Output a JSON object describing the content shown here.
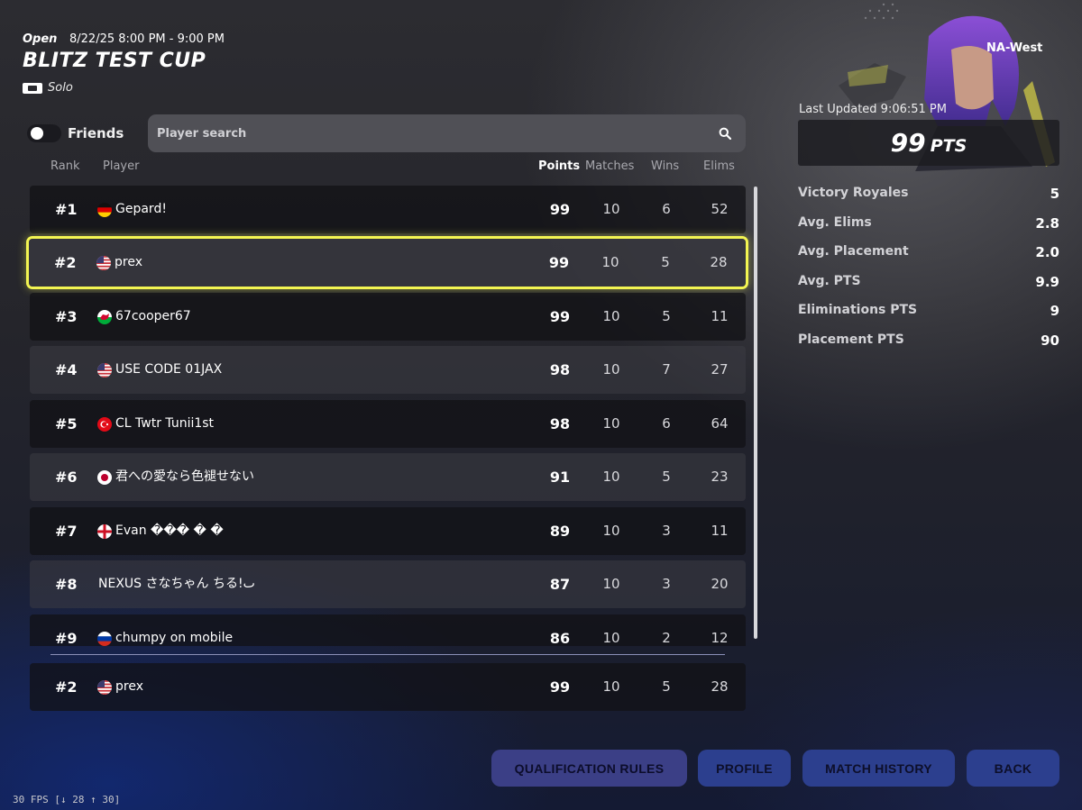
{
  "header": {
    "status": "Open",
    "datetime": "8/22/25 8:00 PM - 9:00 PM",
    "title": "BLITZ TEST CUP",
    "mode": "Solo"
  },
  "filters": {
    "friends_label": "Friends",
    "friends_enabled": false,
    "search_placeholder": "Player search"
  },
  "columns": {
    "rank": "Rank",
    "player": "Player",
    "points": "Points",
    "matches": "Matches",
    "wins": "Wins",
    "elims": "Elims"
  },
  "rows": [
    {
      "rank": "#1",
      "flag": "germany",
      "name": "Gepard!",
      "points": "99",
      "matches": "10",
      "wins": "6",
      "elims": "52"
    },
    {
      "rank": "#2",
      "flag": "usa",
      "name": "prex",
      "points": "99",
      "matches": "10",
      "wins": "5",
      "elims": "28",
      "selected": true
    },
    {
      "rank": "#3",
      "flag": "wales",
      "name": "67cooper67",
      "points": "99",
      "matches": "10",
      "wins": "5",
      "elims": "11"
    },
    {
      "rank": "#4",
      "flag": "usa",
      "name": "USE CODE 01JAX",
      "points": "98",
      "matches": "10",
      "wins": "7",
      "elims": "27"
    },
    {
      "rank": "#5",
      "flag": "turkey",
      "name": "CL Twtr Tunii1st",
      "points": "98",
      "matches": "10",
      "wins": "6",
      "elims": "64"
    },
    {
      "rank": "#6",
      "flag": "japan",
      "name": "君への愛なら色褪せない",
      "points": "91",
      "matches": "10",
      "wins": "5",
      "elims": "23"
    },
    {
      "rank": "#7",
      "flag": "england",
      "name": "Evan ��� � �",
      "points": "89",
      "matches": "10",
      "wins": "3",
      "elims": "11"
    },
    {
      "rank": "#8",
      "flag": "",
      "name": "NEXUS さなちゃん ちる!ٮ",
      "points": "87",
      "matches": "10",
      "wins": "3",
      "elims": "20"
    },
    {
      "rank": "#9",
      "flag": "russia",
      "name": "chumpy on mobile",
      "points": "86",
      "matches": "10",
      "wins": "2",
      "elims": "12"
    }
  ],
  "my_row": {
    "rank": "#2",
    "flag": "usa",
    "name": "prex",
    "points": "99",
    "matches": "10",
    "wins": "5",
    "elims": "28"
  },
  "profile": {
    "region": "NA-West",
    "last_updated": "Last Updated 9:06:51 PM",
    "points_value": "99",
    "points_unit": "PTS",
    "stats": [
      {
        "label": "Victory Royales",
        "value": "5"
      },
      {
        "label": "Avg. Elims",
        "value": "2.8"
      },
      {
        "label": "Avg. Placement",
        "value": "2.0"
      },
      {
        "label": "Avg. PTS",
        "value": "9.9"
      },
      {
        "label": "Eliminations PTS",
        "value": "9"
      },
      {
        "label": "Placement PTS",
        "value": "90"
      }
    ]
  },
  "buttons": {
    "qualification_rules": "QUALIFICATION RULES",
    "profile": "PROFILE",
    "match_history": "MATCH HISTORY",
    "back": "BACK"
  },
  "debug": {
    "fps": "30 FPS [↓ 28 ↑ 30]"
  },
  "colors": {
    "highlight": "#f3f552",
    "button_bg": "#2c3f8e"
  }
}
